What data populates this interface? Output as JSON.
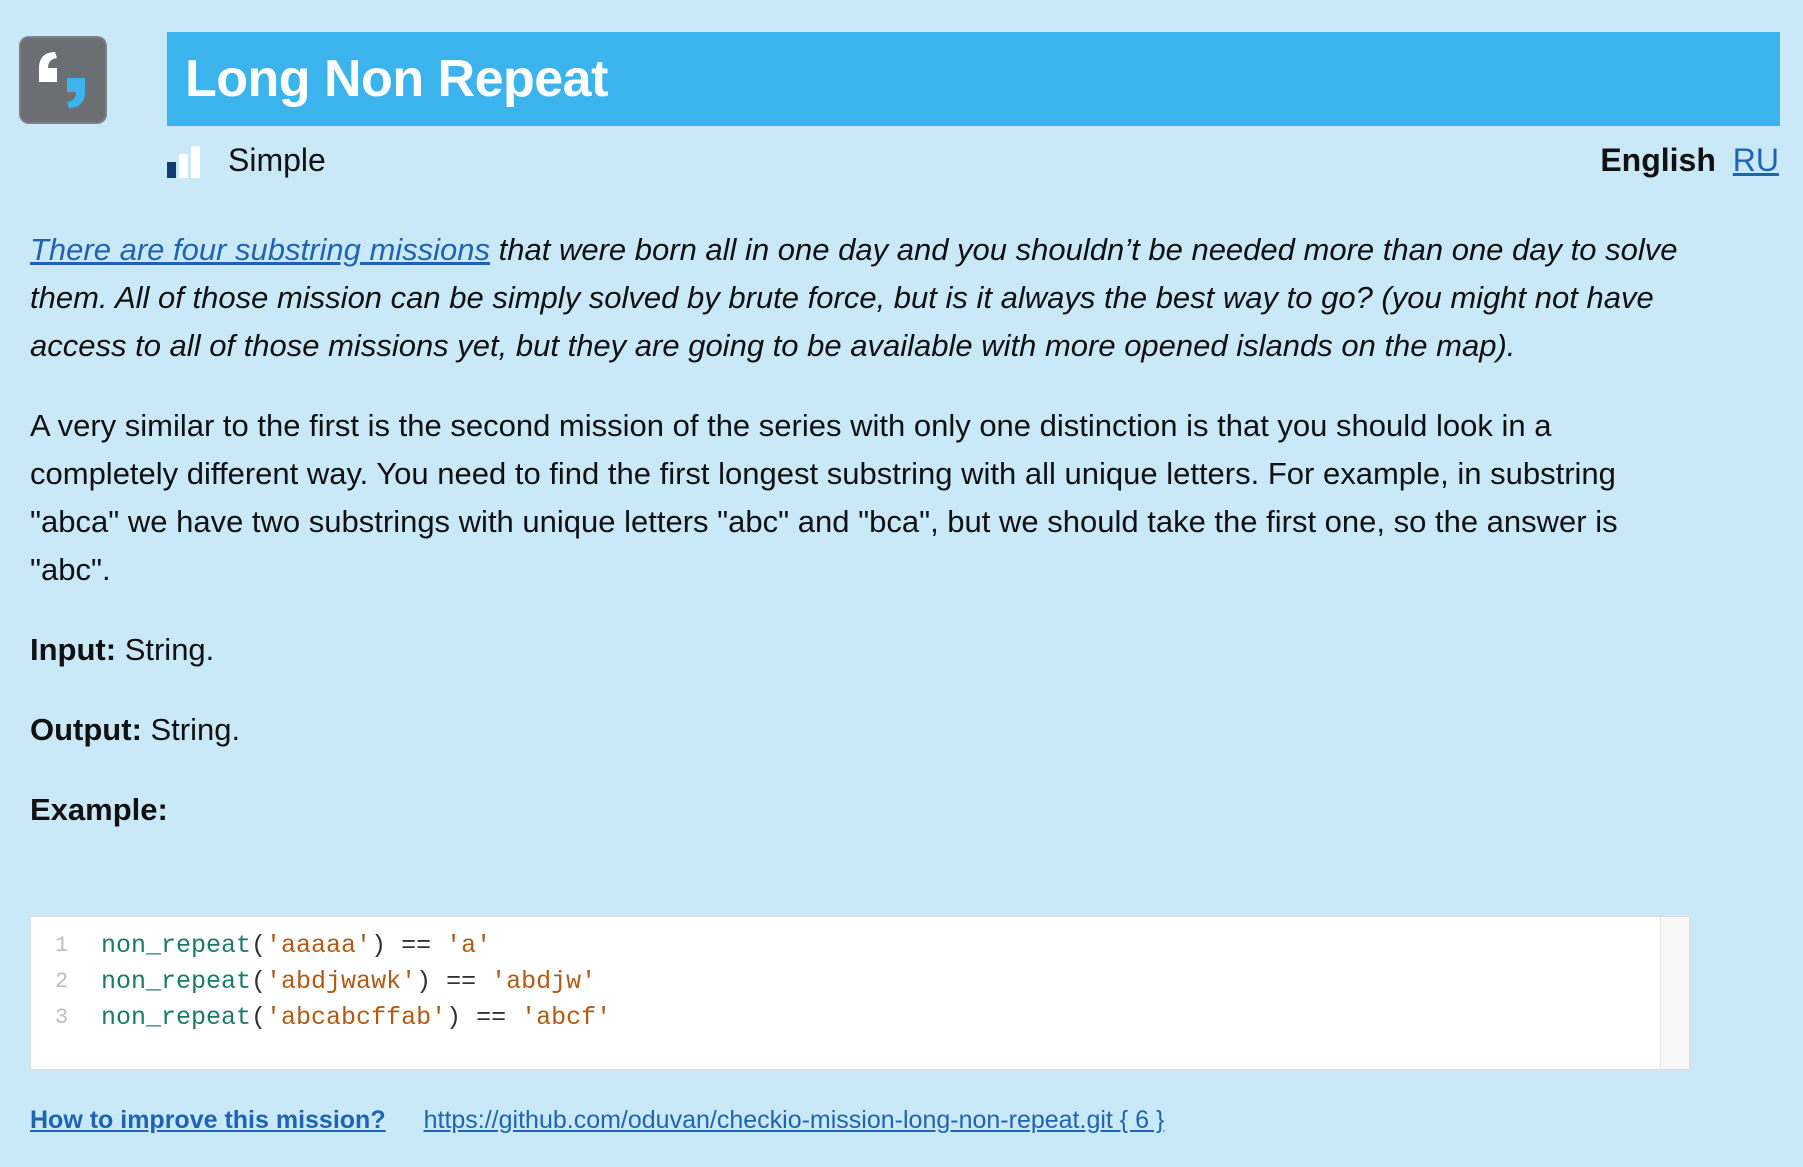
{
  "title": "Long Non Repeat",
  "difficulty": {
    "label": "Simple",
    "level": 1,
    "max_level": 3
  },
  "language": {
    "current": "English",
    "alternate": "RU"
  },
  "intro": {
    "link_text": "There are four substring missions",
    "rest": " that were born all in one day and you shouldn’t be needed more than one day to solve them. All of those mission can be simply solved by brute force, but is it always the best way to go? (you might not have access to all of those missions yet, but they are going to be available with more opened islands on the map)."
  },
  "description": "A very similar to the first is the second mission of the series with only one distinction is that you should look in a completely different way. You need to find the first longest substring with all unique letters. For example, in substring \"abca\" we have two substrings with unique letters \"abc\" and \"bca\", but we should take the first one, so the answer is \"abc\".",
  "input": {
    "label": "Input:",
    "value": " String."
  },
  "output": {
    "label": "Output:",
    "value": " String."
  },
  "example_label": "Example:",
  "code": [
    {
      "line": "1",
      "fn": "non_repeat",
      "arg": "'aaaaa'",
      "op": " == ",
      "res": "'a'"
    },
    {
      "line": "2",
      "fn": "non_repeat",
      "arg": "'abdjwawk'",
      "op": " == ",
      "res": "'abdjw'"
    },
    {
      "line": "3",
      "fn": "non_repeat",
      "arg": "'abcabcffab'",
      "op": " == ",
      "res": "'abcf'"
    }
  ],
  "footer": {
    "improve_label": "How to improve this mission?",
    "repo_link": "https://github.com/oduvan/checkio-mission-long-non-repeat.git { 6 }"
  },
  "colors": {
    "background": "#c9e9f9",
    "title_bar": "#3bb4ed",
    "link": "#1f63b5",
    "code_function": "#1b7a6a",
    "code_string": "#b35a12"
  },
  "icons": {
    "logo": "quote-logo-icon",
    "difficulty": "difficulty-bars-icon"
  }
}
